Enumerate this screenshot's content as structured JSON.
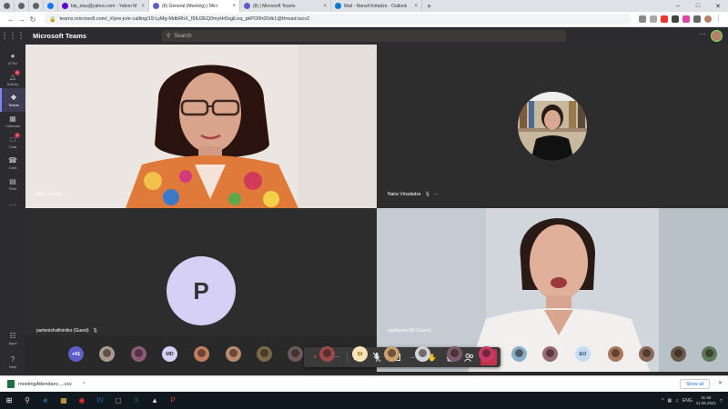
{
  "browser": {
    "tabs": [
      {
        "label": "",
        "type": "icon",
        "color": "#5f6368"
      },
      {
        "label": "",
        "type": "icon",
        "color": "#5f6368"
      },
      {
        "label": "",
        "type": "icon",
        "color": "#5f6368"
      },
      {
        "label": "",
        "type": "icon",
        "color": "#1877f2"
      },
      {
        "label": "bla_etsu@yahoo.com - Yahoo M",
        "color": "#6001d2"
      },
      {
        "label": "(8) General (Meeting) | Micr",
        "color": "#5b5fc7",
        "active": true
      },
      {
        "label": "(8) | Microsoft Teams",
        "color": "#5b5fc7"
      },
      {
        "label": "Mail - Nanuli Kirtadze - Outlook",
        "color": "#0078d4"
      }
    ],
    "new_tab": "+",
    "url": "teams.microsoft.com/_#/pre-join-calling/19:LyMg-MdbRhX_f9IU2EQ0myHr0sgiLoq_pkPO0h00dk1@thread.tacv2"
  },
  "teams": {
    "app_title": "Microsoft Teams",
    "search_placeholder": "Search",
    "more": "···"
  },
  "rail": [
    {
      "icon": "●",
      "label": "ATSU",
      "name": "rail-item-atsu"
    },
    {
      "icon": "△",
      "label": "Activity",
      "badge": "4",
      "name": "rail-item-activity"
    },
    {
      "icon": "❖",
      "label": "Teams",
      "active": true,
      "name": "rail-item-teams"
    },
    {
      "icon": "▦",
      "label": "Calendar",
      "name": "rail-item-calendar"
    },
    {
      "icon": "□",
      "label": "Chat",
      "badge": "1",
      "name": "rail-item-chat"
    },
    {
      "icon": "☎",
      "label": "Calls",
      "name": "rail-item-calls"
    },
    {
      "icon": "▤",
      "label": "Files",
      "name": "rail-item-files"
    },
    {
      "icon": "···",
      "label": "",
      "name": "rail-item-more"
    }
  ],
  "rail_bottom": [
    {
      "icon": "☷",
      "label": "Apps",
      "name": "rail-item-apps"
    },
    {
      "icon": "?",
      "label": "Help",
      "name": "rail-item-help"
    }
  ],
  "tiles": {
    "t1": {
      "name": "Nara Skoria"
    },
    "t2": {
      "name": "Naira Virsaladze",
      "more": "···"
    },
    "t3": {
      "name": "partenishvilininiko (Guest)",
      "initial": "P"
    },
    "t4": {
      "name": "ngulikashvili5 (Guest)"
    }
  },
  "controls": {
    "timer": "— —"
  },
  "participants": [
    {
      "label": "+41",
      "bg": "#5b5fc7",
      "color": "#ffffff"
    },
    {
      "label": "",
      "bg": "#a89a90"
    },
    {
      "label": "",
      "bg": "#8a5a7a"
    },
    {
      "label": "MD",
      "bg": "#d6d0f5",
      "color": "#333333"
    },
    {
      "label": "",
      "bg": "#c07e5e"
    },
    {
      "label": "",
      "bg": "#b88c6a"
    },
    {
      "label": "",
      "bg": "#7a6a4a"
    },
    {
      "label": "",
      "bg": "#6a5a5a"
    },
    {
      "label": "",
      "bg": "#9a4a4a"
    },
    {
      "label": "GI",
      "bg": "#f7e3b5",
      "color": "#8a5a00"
    },
    {
      "label": "",
      "bg": "#c8a070"
    },
    {
      "label": "",
      "bg": "#d0d4d8"
    },
    {
      "label": "",
      "bg": "#7a5a6a"
    },
    {
      "label": "",
      "bg": "#c83a6a"
    },
    {
      "label": "",
      "bg": "#8ab0c8"
    },
    {
      "label": "",
      "bg": "#9a6a7a"
    },
    {
      "label": "EO",
      "bg": "#c8dcf0",
      "color": "#1a4a7a"
    },
    {
      "label": "",
      "bg": "#a8785a"
    },
    {
      "label": "",
      "bg": "#8a6a5a"
    },
    {
      "label": "",
      "bg": "#6a5a4a"
    },
    {
      "label": "",
      "bg": "#5a7a5a"
    }
  ],
  "download": {
    "file": "meetingAttendanc....csv",
    "caret": "^",
    "show_all": "Show all",
    "close": "✕"
  },
  "taskbar": {
    "lang": "ENG",
    "time": "11:46",
    "date": "11.06.2021"
  }
}
